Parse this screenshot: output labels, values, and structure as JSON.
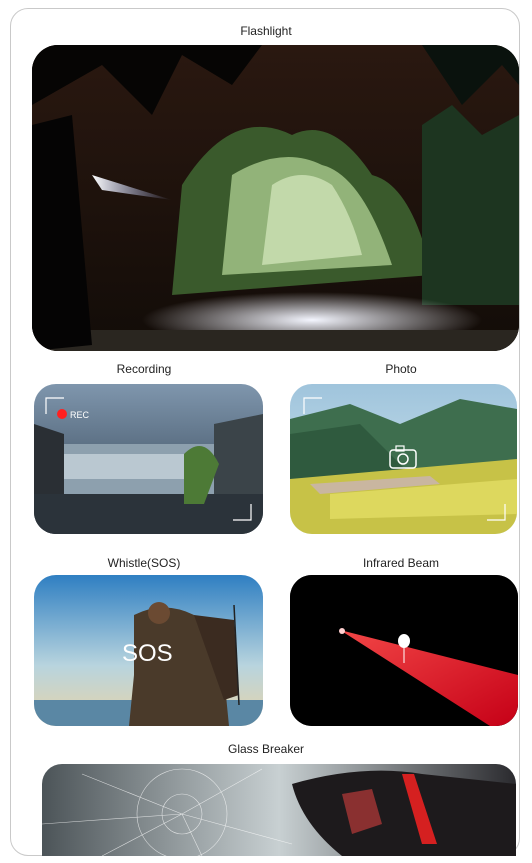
{
  "sections": {
    "flashlight": {
      "label": "Flashlight"
    },
    "recording": {
      "label": "Recording",
      "badge": "REC"
    },
    "photo": {
      "label": "Photo"
    },
    "whistle": {
      "label": "Whistle(SOS)",
      "overlay": "SOS"
    },
    "infrared": {
      "label": "Infrared Beam"
    },
    "glass": {
      "label": "Glass Breaker"
    }
  },
  "icons": [
    "camera-icon",
    "rec-dot-icon",
    "viewfinder-corner-icon"
  ]
}
